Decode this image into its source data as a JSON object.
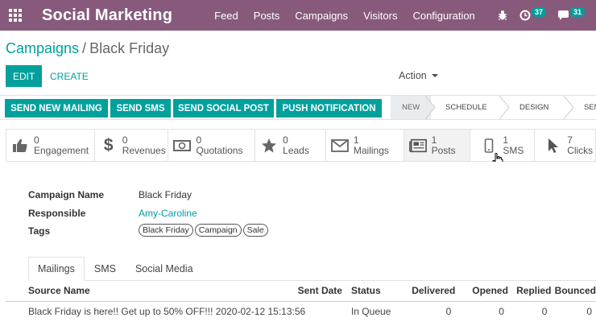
{
  "topbar": {
    "brand": "Social Marketing",
    "menu": [
      "Feed",
      "Posts",
      "Campaigns",
      "Visitors",
      "Configuration"
    ],
    "activity_badge": "37",
    "messages_badge": "31"
  },
  "breadcrumb": {
    "parent": "Campaigns",
    "separator": "/",
    "current": "Black Friday"
  },
  "control": {
    "edit": "EDIT",
    "create": "CREATE",
    "action": "Action"
  },
  "header_buttons": [
    "SEND NEW MAILING",
    "SEND SMS",
    "SEND SOCIAL POST",
    "PUSH NOTIFICATION"
  ],
  "stages": [
    "NEW",
    "SCHEDULE",
    "DESIGN",
    "SENT"
  ],
  "stats": [
    {
      "num": "0",
      "label": "Engagement",
      "icon": "thumbs-up-icon"
    },
    {
      "num": "0",
      "label": "Revenues",
      "icon": "dollar-icon"
    },
    {
      "num": "0",
      "label": "Quotations",
      "icon": "money-icon"
    },
    {
      "num": "0",
      "label": "Leads",
      "icon": "star-icon"
    },
    {
      "num": "1",
      "label": "Mailings",
      "icon": "envelope-icon"
    },
    {
      "num": "1",
      "label": "Posts",
      "icon": "newspaper-icon"
    },
    {
      "num": "1",
      "label": "SMS",
      "icon": "mobile-icon"
    },
    {
      "num": "7",
      "label": "Clicks",
      "icon": "pointer-icon"
    }
  ],
  "fields": {
    "campaign_name_label": "Campaign Name",
    "campaign_name": "Black Friday",
    "responsible_label": "Responsible",
    "responsible": "Amy-Caroline",
    "tags_label": "Tags",
    "tags": [
      "Black Friday",
      "Campaign",
      "Sale"
    ]
  },
  "tabs": [
    "Mailings",
    "SMS",
    "Social Media"
  ],
  "table": {
    "headers": [
      "Source Name",
      "Sent Date",
      "Status",
      "Delivered",
      "Opened",
      "Replied",
      "Bounced"
    ],
    "rows": [
      [
        "Black Friday is here!! Get up to 50% OFF!!!",
        "2020-02-12 15:13:56",
        "In Queue",
        "0",
        "0",
        "0",
        "0"
      ]
    ]
  }
}
